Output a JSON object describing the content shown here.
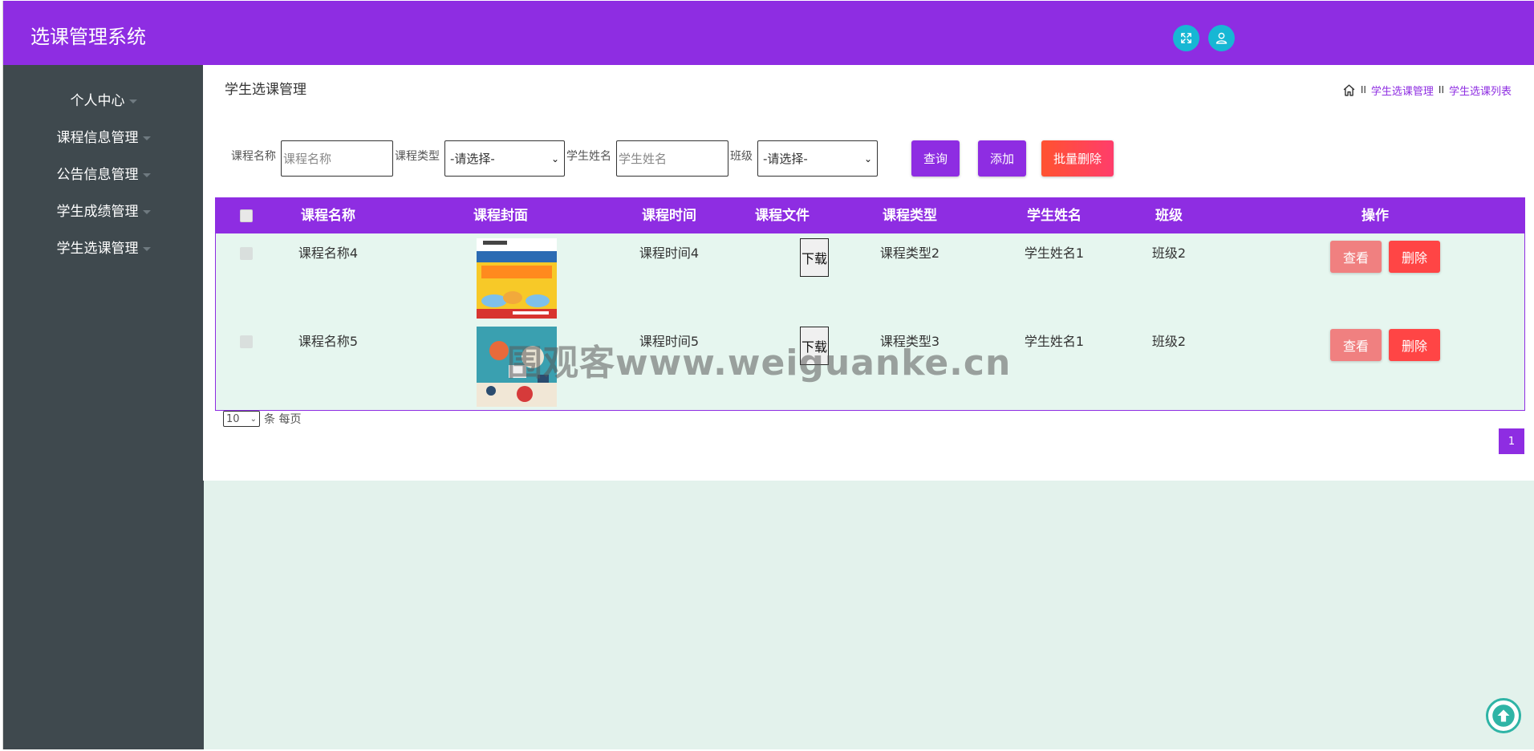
{
  "app": {
    "title": "选课管理系统"
  },
  "sidebar": {
    "items": [
      {
        "label": "个人中心"
      },
      {
        "label": "课程信息管理"
      },
      {
        "label": "公告信息管理"
      },
      {
        "label": "学生成绩管理"
      },
      {
        "label": "学生选课管理"
      }
    ]
  },
  "page": {
    "title": "学生选课管理",
    "breadcrumb": [
      "学生选课管理",
      "学生选课列表"
    ],
    "breadcrumb_sep": "II"
  },
  "search": {
    "course_name_label": "课程名称",
    "course_name_placeholder": "课程名称",
    "course_type_label": "课程类型",
    "course_type_value": "-请选择-",
    "student_name_label": "学生姓名",
    "student_name_placeholder": "学生姓名",
    "class_label": "班级",
    "class_value": "-请选择-",
    "query_button": "查询",
    "add_button": "添加",
    "batch_delete_button": "批量删除"
  },
  "table": {
    "columns": [
      "课程名称",
      "课程封面",
      "课程时间",
      "课程文件",
      "课程类型",
      "学生姓名",
      "班级",
      "操作"
    ],
    "rows": [
      {
        "course_name": "课程名称4",
        "course_time": "课程时间4",
        "file_button": "下载",
        "course_type": "课程类型2",
        "student_name": "学生姓名1",
        "class": "班级2",
        "view_button": "查看",
        "delete_button": "删除"
      },
      {
        "course_name": "课程名称5",
        "course_time": "课程时间5",
        "file_button": "下载",
        "course_type": "课程类型3",
        "student_name": "学生姓名1",
        "class": "班级2",
        "view_button": "查看",
        "delete_button": "删除"
      }
    ]
  },
  "pagination": {
    "page_size": "10",
    "per_page_label": "条 每页",
    "current_page": "1"
  },
  "watermark": "围观客www.weiguanke.cn",
  "colors": {
    "brand": "#8e2de2",
    "sidebar": "#3f494e",
    "content_bg": "#e3f2ec",
    "danger": "#ff4545",
    "icon_button": "#17b7d4"
  },
  "icons": {
    "fullscreen": "fullscreen-icon",
    "user": "user-icon",
    "home": "home-icon",
    "back_to_top": "arrow-up-icon"
  }
}
